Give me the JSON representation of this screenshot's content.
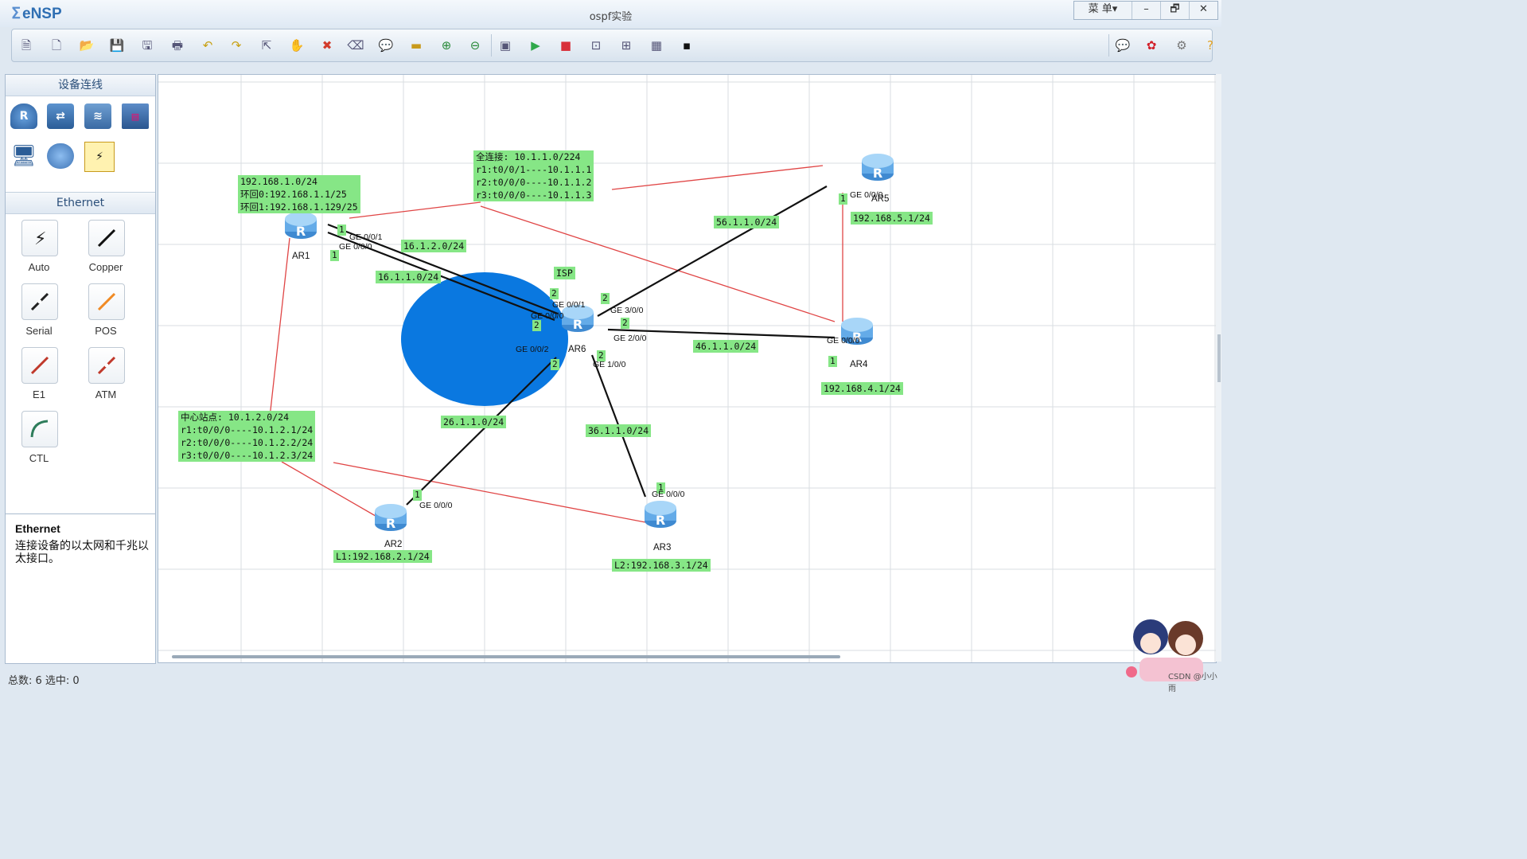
{
  "app": {
    "logo": "eNSP",
    "window_title": "ospf实验",
    "menu_label": "菜 单▾"
  },
  "window_controls": {
    "minimize": "–",
    "restore": "🗗",
    "close": "✕"
  },
  "toolbar": {
    "left_icons": [
      "new-topology-icon",
      "new-lab-icon",
      "open-icon",
      "save-icon",
      "save-as-icon",
      "print-icon",
      "undo-icon",
      "redo-icon",
      "select-icon",
      "hand-icon",
      "delete-icon",
      "delete-all-links-icon",
      "text-icon",
      "rectangle-icon",
      "zoom-in-icon",
      "zoom-out-icon",
      "fit-icon",
      "start-icon",
      "stop-icon",
      "capture-icon",
      "topology-icon",
      "grid-icon",
      "terminal-icon"
    ],
    "right_icons": [
      "chat-icon",
      "huawei-icon",
      "settings-icon",
      "help-icon"
    ]
  },
  "left_panel": {
    "device_header": "设备连线",
    "cable_header": "Ethernet",
    "cables": [
      {
        "label": "Auto",
        "color": "#222222",
        "icon": "auto-cable-icon"
      },
      {
        "label": "Copper",
        "color": "#111111",
        "icon": "copper-cable-icon"
      },
      {
        "label": "Serial",
        "color": "#222222",
        "icon": "serial-cable-icon"
      },
      {
        "label": "POS",
        "color": "#f08a24",
        "icon": "pos-cable-icon"
      },
      {
        "label": "E1",
        "color": "#c0392b",
        "icon": "e1-cable-icon"
      },
      {
        "label": "ATM",
        "color": "#c0392b",
        "icon": "atm-cable-icon"
      },
      {
        "label": "CTL",
        "color": "#2e7d5b",
        "icon": "ctl-cable-icon"
      }
    ],
    "desc_title": "Ethernet",
    "desc_text": "连接设备的以太网和千兆以太接口。"
  },
  "topology": {
    "routers": [
      {
        "name": "AR1"
      },
      {
        "name": "AR2"
      },
      {
        "name": "AR3"
      },
      {
        "name": "AR4"
      },
      {
        "name": "AR5"
      },
      {
        "name": "AR6"
      }
    ],
    "isp_label": "ISP",
    "notes": {
      "ar1": "192.168.1.0/24\n环回0:192.168.1.1/25\n环回1:192.168.1.129/25",
      "full_mesh": "全连接: 10.1.1.0/224\nr1:t0/0/1----10.1.1.1\nr2:t0/0/0----10.1.1.2\nr3:t0/0/0----10.1.1.3",
      "hub": "中心站点: 10.1.2.0/24\nr1:t0/0/0----10.1.2.1/24\nr2:t0/0/0----10.1.2.2/24\nr3:t0/0/0----10.1.2.3/24",
      "n16_1_2": "16.1.2.0/24",
      "n16_1_1": "16.1.1.0/24",
      "n56": "56.1.1.0/24",
      "n46": "46.1.1.0/24",
      "n26": "26.1.1.0/24",
      "n36": "36.1.1.0/24",
      "ar5_net": "192.168.5.1/24",
      "ar4_net": "192.168.4.1/24",
      "ar2_net": "L1:192.168.2.1/24",
      "ar3_net": "L2:192.168.3.1/24"
    },
    "ports": {
      "ar1_g001": "GE 0/0/1",
      "ar1_g000": "GE 0/0/0",
      "ar6_g001": "GE 0/0/1",
      "ar6_g000": "GE 0/0/0",
      "ar6_g300": "GE 3/0/0",
      "ar6_g200": "GE 2/0/0",
      "ar6_g002": "GE 0/0/2",
      "ar6_g100": "GE 1/0/0",
      "ar5_g000": "GE 0/0/0",
      "ar4_g000": "GE 0/0/0",
      "ar2_g000": "GE 0/0/0",
      "ar3_g000": "GE 0/0/0"
    },
    "port_numbers": {
      "one": "1",
      "two": "2"
    }
  },
  "status": {
    "text": "总数: 6 选中: 0"
  },
  "watermark": "CSDN @小小雨"
}
